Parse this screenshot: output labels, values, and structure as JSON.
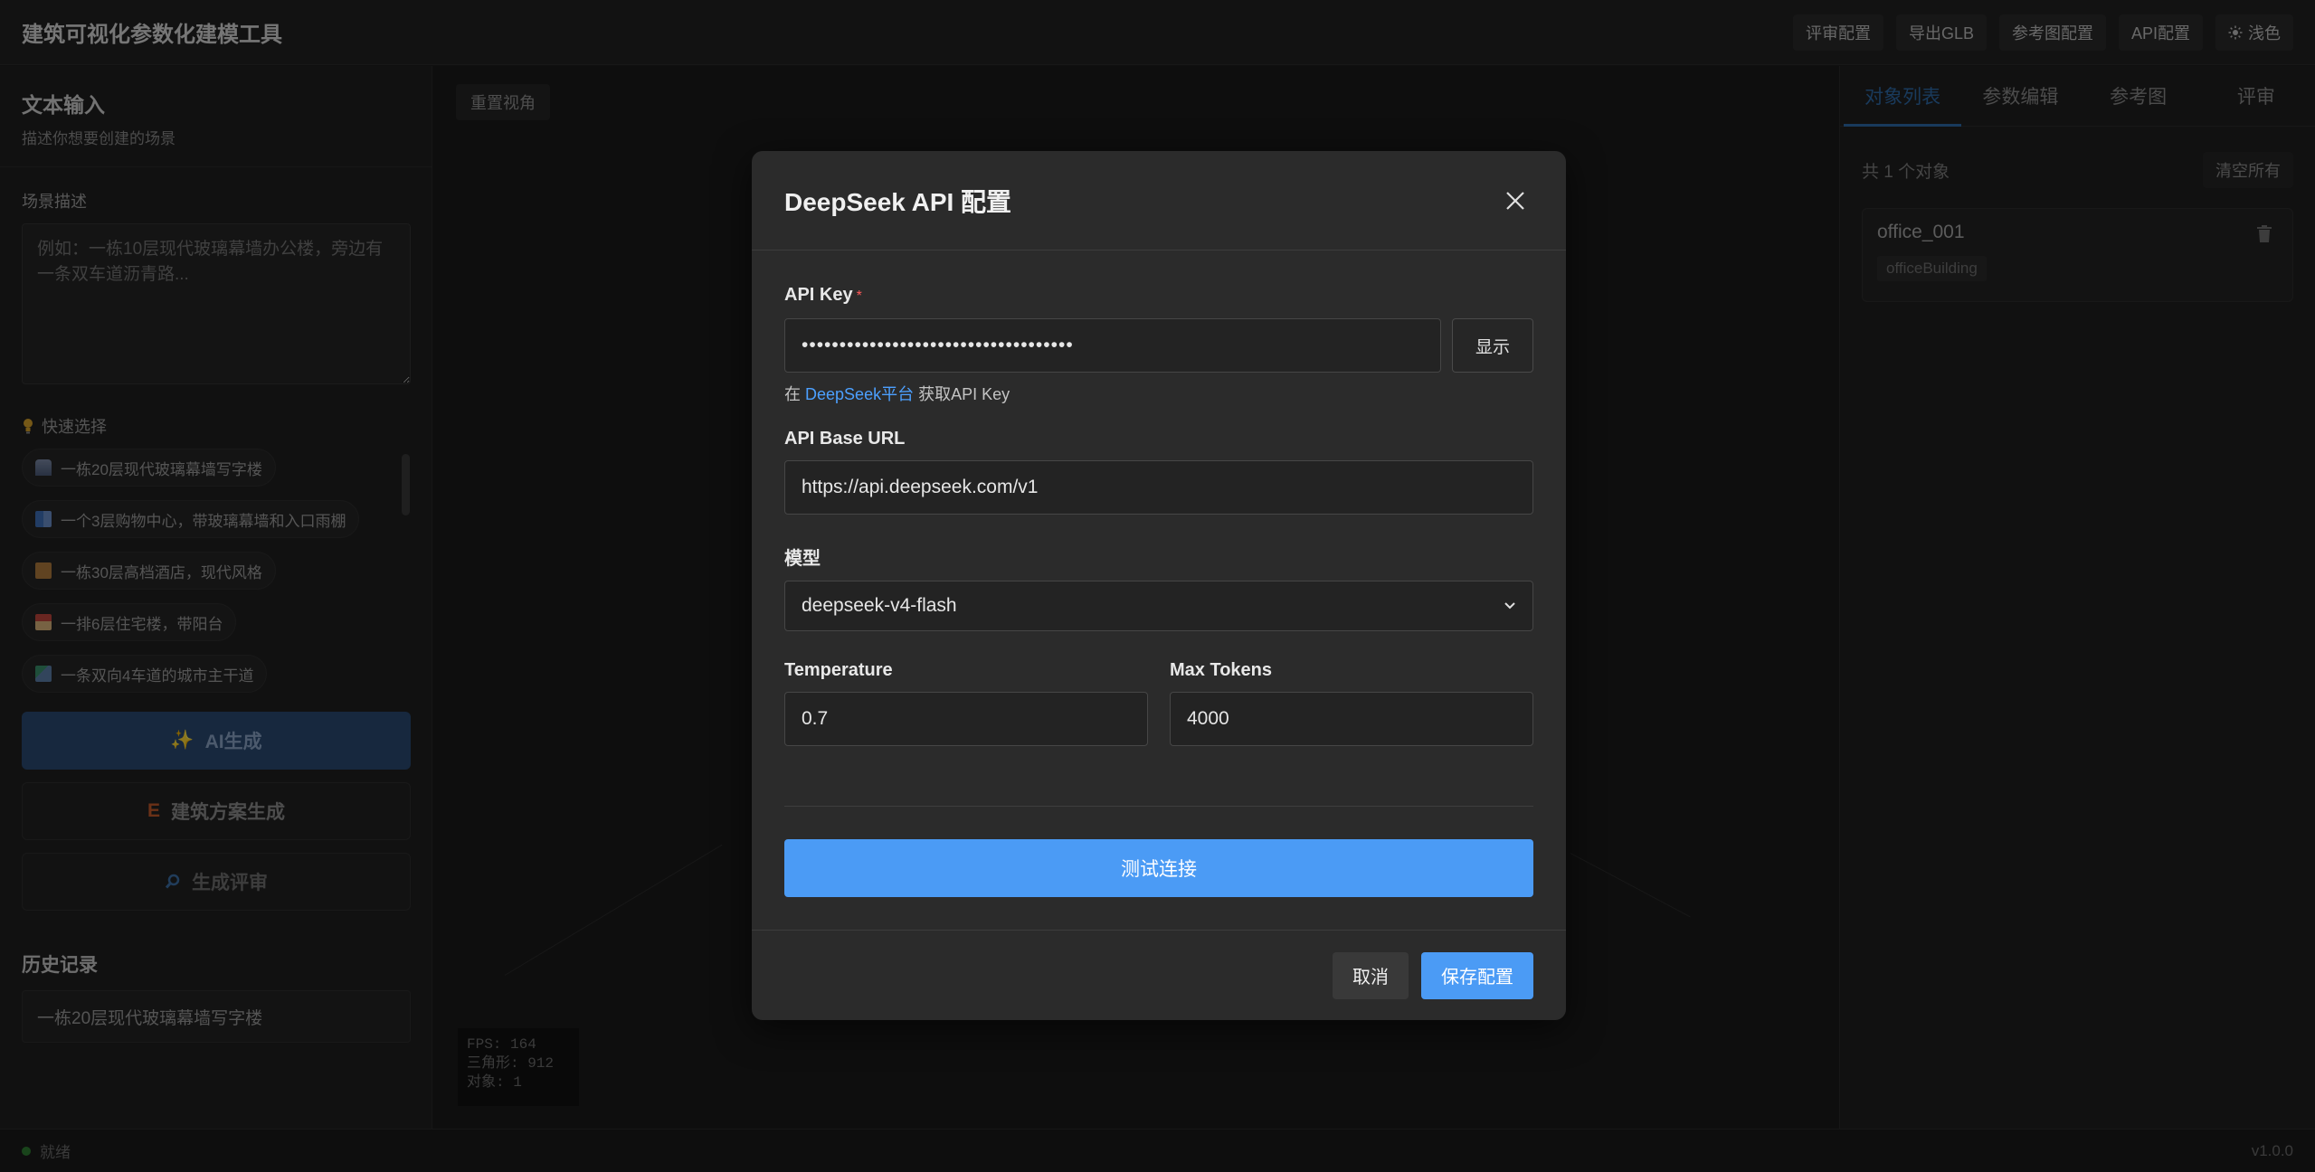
{
  "header": {
    "title": "建筑可视化参数化建模工具",
    "actions": [
      {
        "label": "评审配置",
        "name": "review-config-button"
      },
      {
        "label": "导出GLB",
        "name": "export-glb-button"
      },
      {
        "label": "参考图配置",
        "name": "reference-image-config-button"
      },
      {
        "label": "API配置",
        "name": "api-config-button"
      }
    ],
    "theme_toggle": {
      "icon": "sun-icon",
      "label": "浅色"
    }
  },
  "left_panel": {
    "title": "文本输入",
    "subtitle": "描述你想要创建的场景",
    "scene_label": "场景描述",
    "scene_placeholder": "例如：一栋10层现代玻璃幕墙办公楼，旁边有一条双车道沥青路...",
    "quick_select_label": "快速选择",
    "quick_items": [
      {
        "label": "一栋20层现代玻璃幕墙写字楼",
        "icon": "office-building-icon"
      },
      {
        "label": "一个3层购物中心，带玻璃幕墙和入口雨棚",
        "icon": "shopping-mall-icon"
      },
      {
        "label": "一栋30层高档酒店，现代风格",
        "icon": "hotel-icon"
      },
      {
        "label": "一排6层住宅楼，带阳台",
        "icon": "house-icon"
      },
      {
        "label": "一条双向4车道的城市主干道",
        "icon": "road-icon"
      }
    ],
    "ai_generate_label": "AI生成",
    "plan_generate_label": "建筑方案生成",
    "review_generate_label": "生成评审",
    "history_title": "历史记录",
    "history_items": [
      "一栋20层现代玻璃幕墙写字楼"
    ]
  },
  "viewport": {
    "reset_view_label": "重置视角",
    "stats": {
      "fps": "FPS: 164",
      "triangles": "三角形: 912",
      "objects": "对象: 1"
    }
  },
  "right_panel": {
    "tabs": [
      "对象列表",
      "参数编辑",
      "参考图",
      "评审"
    ],
    "active_tab": 0,
    "object_count": "共 1 个对象",
    "clear_all_label": "清空所有",
    "objects": [
      {
        "name": "office_001",
        "type": "officeBuilding"
      }
    ]
  },
  "status_bar": {
    "status": "就绪",
    "version": "v1.0.0"
  },
  "modal": {
    "title": "DeepSeek API 配置",
    "api_key_label": "API Key",
    "required_mark": "*",
    "api_key_value": "••••••••••••••••••••••••••••••••••••",
    "show_label": "显示",
    "hint_prefix": "在",
    "hint_link": "DeepSeek平台",
    "hint_suffix": "获取API Key",
    "base_url_label": "API Base URL",
    "base_url_value": "https://api.deepseek.com/v1",
    "model_label": "模型",
    "model_value": "deepseek-v4-flash",
    "temperature_label": "Temperature",
    "temperature_value": "0.7",
    "max_tokens_label": "Max Tokens",
    "max_tokens_value": "4000",
    "test_label": "测试连接",
    "cancel_label": "取消",
    "save_label": "保存配置"
  },
  "colors": {
    "accent": "#4b9bf5",
    "tab_active": "#2f6aa8",
    "required": "#ff5a5a",
    "status_ok": "#2e7d32"
  }
}
